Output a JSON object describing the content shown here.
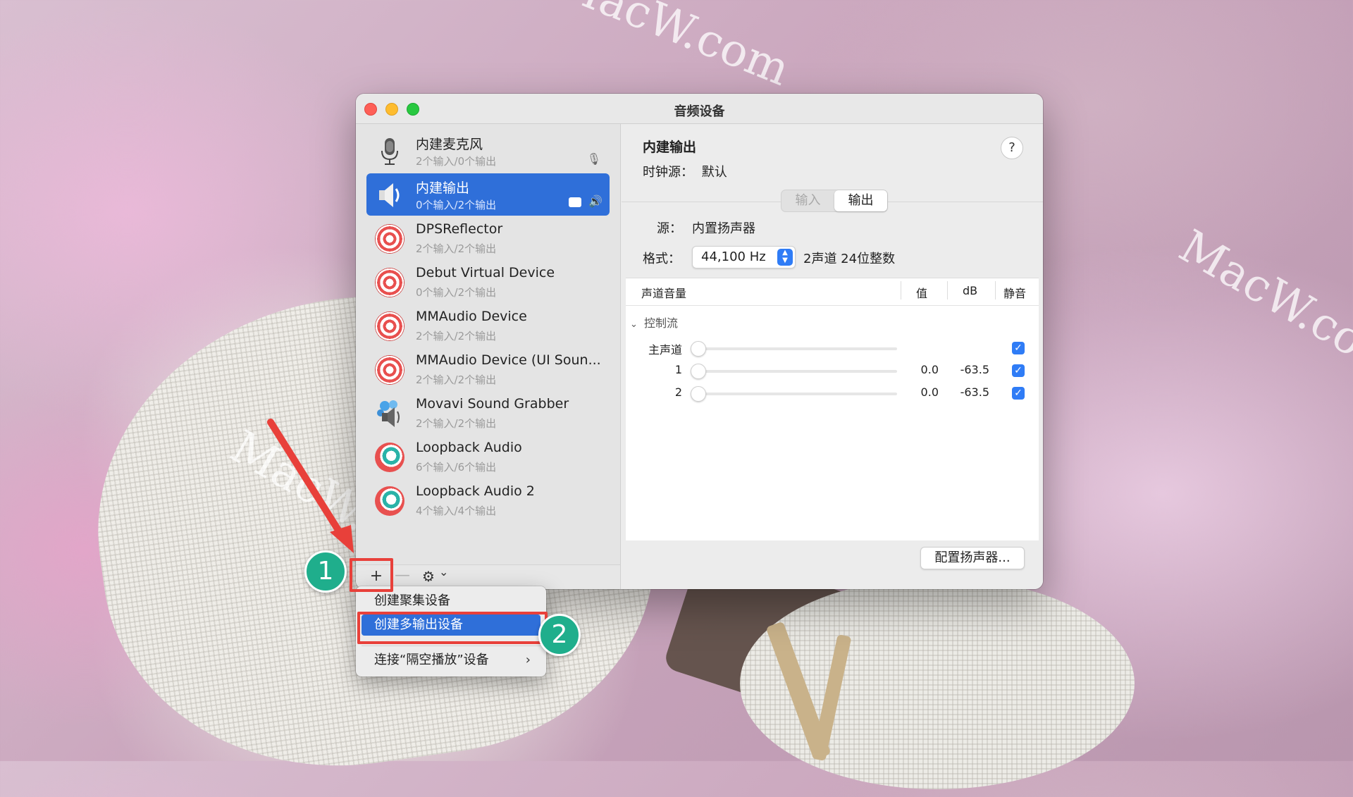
{
  "window": {
    "title": "音频设备"
  },
  "devices": [
    {
      "name": "内建麦克风",
      "io": "2个输入/0个输出",
      "icon": "microphone-icon"
    },
    {
      "name": "内建输出",
      "io": "0个输入/2个输出",
      "icon": "speaker-icon",
      "selected": true
    },
    {
      "name": "DPSReflector",
      "io": "2个输入/2个输出",
      "icon": "target-icon"
    },
    {
      "name": "Debut Virtual Device",
      "io": "0个输入/2个输出",
      "icon": "target-icon"
    },
    {
      "name": "MMAudio Device",
      "io": "2个输入/2个输出",
      "icon": "target-icon"
    },
    {
      "name": "MMAudio Device (UI Soun...",
      "io": "2个输入/2个输出",
      "icon": "target-icon"
    },
    {
      "name": "Movavi Sound Grabber",
      "io": "2个输入/2个输出",
      "icon": "speaker-icon"
    },
    {
      "name": "Loopback Audio",
      "io": "6个输入/6个输出",
      "icon": "loopback-icon"
    },
    {
      "name": "Loopback Audio 2",
      "io": "4个输入/4个输出",
      "icon": "loopback-icon"
    }
  ],
  "toolbar": {
    "add": "+",
    "remove": "—",
    "gear": "⚙",
    "chevron": "⌄"
  },
  "detail": {
    "title": "内建输出",
    "clock_label": "时钟源：",
    "clock_value": "默认",
    "help": "?",
    "tab_input": "输入",
    "tab_output": "输出",
    "source_label": "源：",
    "source_value": "内置扬声器",
    "format_label": "格式：",
    "format_value": "44,100 Hz",
    "format_desc": "2声道 24位整数",
    "config_button": "配置扬声器..."
  },
  "table": {
    "headers": {
      "volume": "声道音量",
      "value": "值",
      "db": "dB",
      "mute": "静音"
    },
    "group": "控制流",
    "rows": [
      {
        "label": "主声道",
        "value": "",
        "db": "",
        "muted": true
      },
      {
        "label": "1",
        "value": "0.0",
        "db": "-63.5",
        "muted": true
      },
      {
        "label": "2",
        "value": "0.0",
        "db": "-63.5",
        "muted": true
      }
    ]
  },
  "menu": {
    "items": [
      "创建聚集设备",
      "创建多输出设备",
      "连接“隔空播放”设备"
    ],
    "submenu_arrow": "›"
  },
  "annotations": {
    "step1": "1",
    "step2": "2"
  },
  "watermarks": [
    "MacW.com",
    "MacW.co",
    "MacW.com"
  ],
  "colors": {
    "accent": "#2f6fd9",
    "step_badge": "#1fae8c",
    "highlight_box": "#e8403a"
  }
}
